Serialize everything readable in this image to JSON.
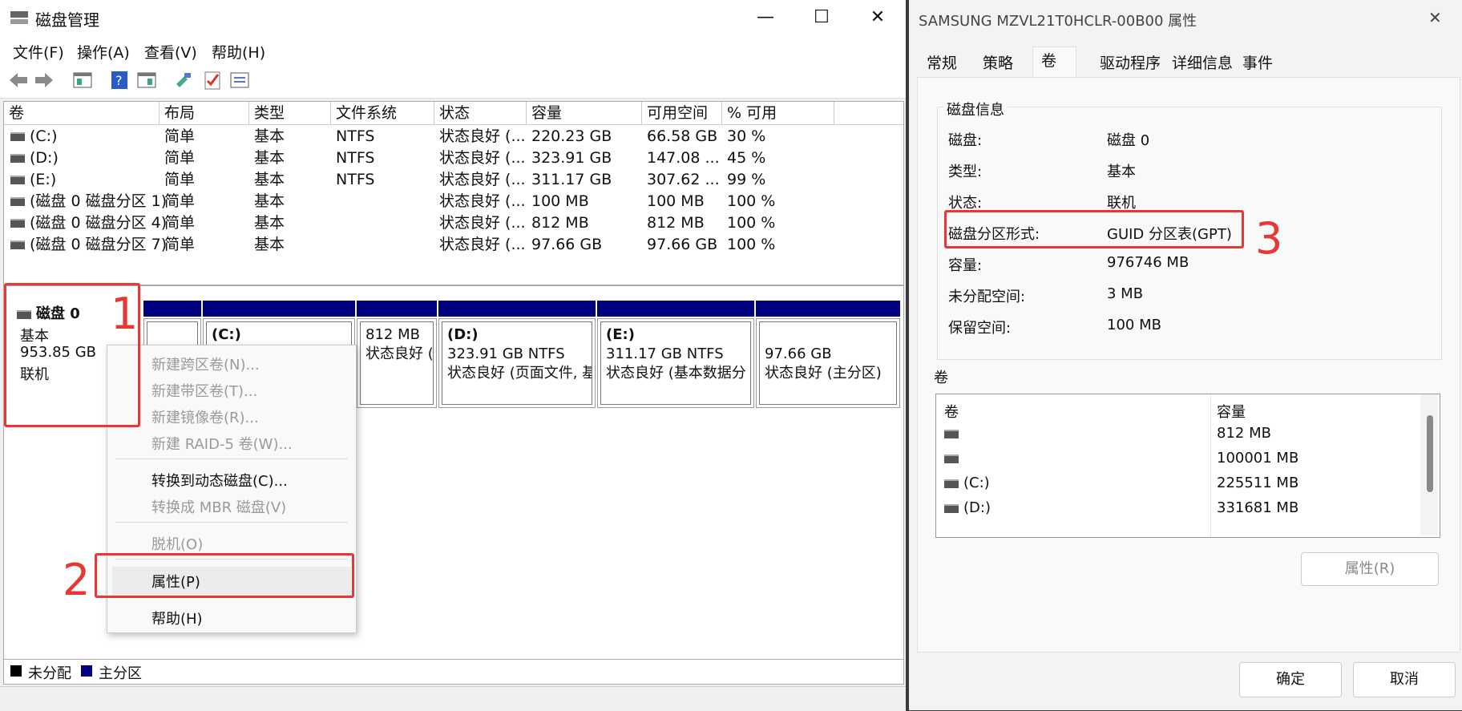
{
  "left_window": {
    "title": "磁盘管理",
    "controls": {
      "minimize": "—",
      "maximize": "☐",
      "close": "✕"
    },
    "menu": [
      "文件(F)",
      "操作(A)",
      "查看(V)",
      "帮助(H)"
    ],
    "columns": [
      "卷",
      "布局",
      "类型",
      "文件系统",
      "状态",
      "容量",
      "可用空间",
      "% 可用"
    ],
    "rows": [
      [
        "(C:)",
        "简单",
        "基本",
        "NTFS",
        "状态良好 (...",
        "220.23 GB",
        "66.58 GB",
        "30 %"
      ],
      [
        "(D:)",
        "简单",
        "基本",
        "NTFS",
        "状态良好 (...",
        "323.91 GB",
        "147.08 ...",
        "45 %"
      ],
      [
        "(E:)",
        "简单",
        "基本",
        "NTFS",
        "状态良好 (...",
        "311.17 GB",
        "307.62 ...",
        "99 %"
      ],
      [
        "(磁盘 0 磁盘分区 1)",
        "简单",
        "基本",
        "",
        "状态良好 (...",
        "100 MB",
        "100 MB",
        "100 %"
      ],
      [
        "(磁盘 0 磁盘分区 4)",
        "简单",
        "基本",
        "",
        "状态良好 (...",
        "812 MB",
        "812 MB",
        "100 %"
      ],
      [
        "(磁盘 0 磁盘分区 7)",
        "简单",
        "基本",
        "",
        "状态良好 (...",
        "97.66 GB",
        "97.66 GB",
        "100 %"
      ]
    ],
    "disk": {
      "name": "磁盘 0",
      "type": "基本",
      "size": "953.85 GB",
      "status": "联机"
    },
    "partitions": [
      {
        "title": "(C:)",
        "line1": "",
        "line2": ""
      },
      {
        "title": "",
        "line1": "812 MB",
        "line2": "状态良好 ("
      },
      {
        "title": "(D:)",
        "line1": "323.91 GB NTFS",
        "line2": "状态良好 (页面文件, 基"
      },
      {
        "title": "(E:)",
        "line1": "311.17 GB NTFS",
        "line2": "状态良好 (基本数据分"
      },
      {
        "title": "",
        "line1": "97.66 GB",
        "line2": "状态良好 (主分区)"
      }
    ],
    "legend": {
      "unallocated": "未分配",
      "primary": "主分区"
    },
    "legend_colors": {
      "unallocated": "#000000",
      "primary": "#000080"
    }
  },
  "context_menu": {
    "items": [
      {
        "label": "新建跨区卷(N)...",
        "disabled": true
      },
      {
        "label": "新建带区卷(T)...",
        "disabled": true
      },
      {
        "label": "新建镜像卷(R)...",
        "disabled": true
      },
      {
        "label": "新建 RAID-5 卷(W)...",
        "disabled": true
      },
      {
        "label": "转换到动态磁盘(C)...",
        "disabled": false
      },
      {
        "label": "转换成 MBR 磁盘(V)",
        "disabled": true
      },
      {
        "label": "脱机(O)",
        "disabled": true
      },
      {
        "label": "属性(P)",
        "disabled": false
      },
      {
        "label": "帮助(H)",
        "disabled": false
      }
    ]
  },
  "annotations": {
    "one": "1",
    "two": "2",
    "three": "3",
    "color": "#e53935"
  },
  "properties": {
    "title": "SAMSUNG MZVL21T0HCLR-00B00 属性",
    "close": "✕",
    "tabs": [
      "常规",
      "策略",
      "卷",
      "驱动程序",
      "详细信息",
      "事件"
    ],
    "active_tab": "卷",
    "disk_info_heading": "磁盘信息",
    "info": [
      {
        "label": "磁盘:",
        "value": "磁盘 0"
      },
      {
        "label": "类型:",
        "value": "基本"
      },
      {
        "label": "状态:",
        "value": "联机"
      },
      {
        "label": "磁盘分区形式:",
        "value": "GUID 分区表(GPT)"
      },
      {
        "label": "容量:",
        "value": "976746 MB"
      },
      {
        "label": "未分配空间:",
        "value": "3 MB"
      },
      {
        "label": "保留空间:",
        "value": "100 MB"
      }
    ],
    "volumes_heading": "卷",
    "volume_columns": [
      "卷",
      "容量"
    ],
    "volumes": [
      {
        "name": "",
        "size": "812 MB"
      },
      {
        "name": "",
        "size": "100001 MB"
      },
      {
        "name": "(C:)",
        "size": "225511 MB"
      },
      {
        "name": "(D:)",
        "size": "331681 MB"
      }
    ],
    "properties_button": "属性(R)",
    "ok_button": "确定",
    "cancel_button": "取消"
  }
}
